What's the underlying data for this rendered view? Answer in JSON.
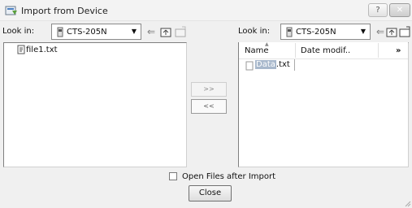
{
  "window": {
    "title": "Import from Device",
    "help_label": "?",
    "close_label": "✕"
  },
  "left": {
    "look_in_label": "Look in:",
    "location": "CTS-205N",
    "files": [
      "file1.txt"
    ]
  },
  "right": {
    "look_in_label": "Look in:",
    "location": "CTS-205N",
    "columns": [
      "Name",
      "Date modif..",
      "»"
    ],
    "files": [
      {
        "name_part1": "Data",
        "name_part2": ".txt"
      }
    ]
  },
  "transfer": {
    "to_right": ">>",
    "to_left": "<<"
  },
  "footer": {
    "checkbox_label": "Open Files after Import",
    "close_label": "Close"
  }
}
